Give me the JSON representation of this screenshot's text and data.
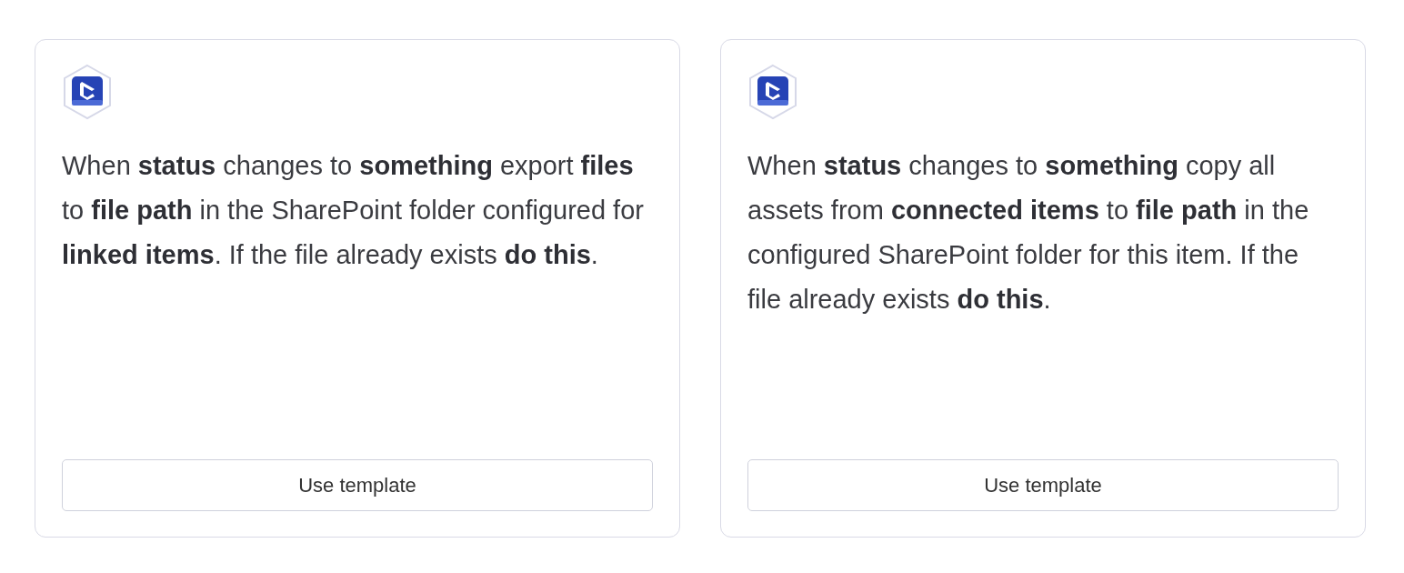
{
  "templates": [
    {
      "description": "When **status** changes to **something** export **files** to **file path** in the SharePoint folder configured for **linked items**. If the file already exists **do this**.",
      "button": "Use template"
    },
    {
      "description": "When **status** changes to **something** copy all assets from **connected items** to **file path** in the configured SharePoint folder for this item. If the file already exists **do this**.",
      "button": "Use template"
    }
  ]
}
